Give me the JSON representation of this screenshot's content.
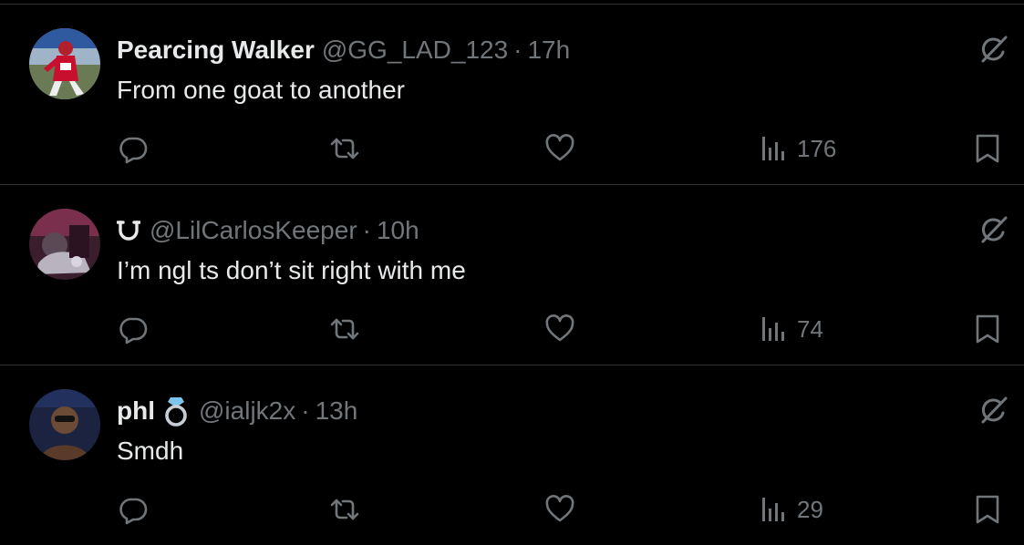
{
  "tweets": [
    {
      "name": "Pearcing Walker",
      "name_prefix_icon": "",
      "badge_icon": "",
      "handle": "@GG_LAD_123",
      "separator": "·",
      "time": "17h",
      "text": "From one goat to another",
      "views": "176"
    },
    {
      "name": "",
      "name_prefix_icon": "horseshoe-icon",
      "badge_icon": "",
      "handle": "@LilCarlosKeeper",
      "separator": "·",
      "time": "10h",
      "text": "I’m ngl ts don’t sit right with me",
      "views": "74"
    },
    {
      "name": "phl",
      "name_prefix_icon": "",
      "badge_icon": "ring-icon",
      "handle": "@ialjk2x",
      "separator": "·",
      "time": "13h",
      "text": "Smdh",
      "views": "29"
    }
  ],
  "icons": {
    "reply": "reply-icon",
    "retweet": "retweet-icon",
    "like": "heart-icon",
    "views": "views-icon",
    "bookmark": "bookmark-icon",
    "grok": "grok-icon"
  },
  "colors": {
    "background": "#000000",
    "primary_text": "#e7e9ea",
    "secondary_text": "#71767b",
    "divider": "#2f3336"
  }
}
